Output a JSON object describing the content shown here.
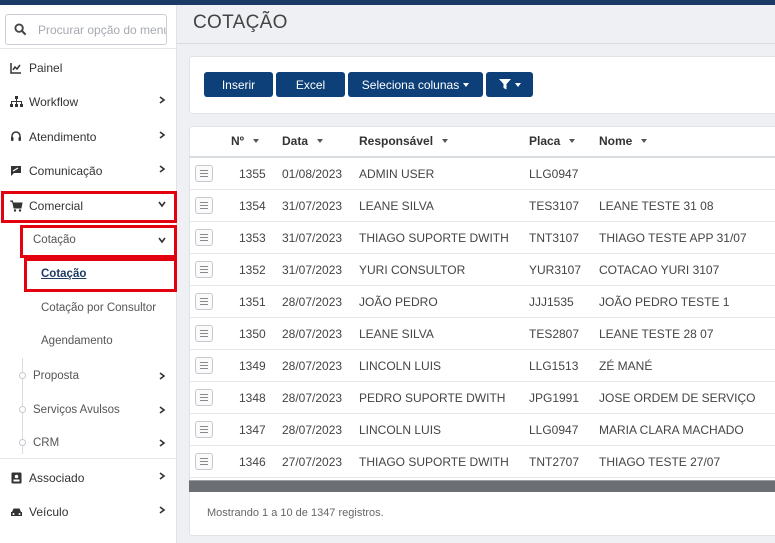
{
  "sidebar": {
    "search_placeholder": "Procurar opção do menu",
    "items": [
      {
        "label": "Painel",
        "icon": "chart-line-icon"
      },
      {
        "label": "Workflow",
        "icon": "sitemap-icon"
      },
      {
        "label": "Atendimento",
        "icon": "headset-icon"
      },
      {
        "label": "Comunicação",
        "icon": "message-icon"
      },
      {
        "label": "Comercial",
        "icon": "cart-icon"
      },
      {
        "label": "Associado",
        "icon": "id-card-icon"
      },
      {
        "label": "Veículo",
        "icon": "car-icon"
      }
    ],
    "comercial_children": {
      "cotacao_group": "Cotação",
      "cotacao_links": [
        "Cotação",
        "Cotação por Consultor",
        "Agendamento"
      ],
      "others": [
        "Proposta",
        "Serviços Avulsos",
        "CRM"
      ]
    }
  },
  "page": {
    "title": "COTAÇÃO"
  },
  "toolbar": {
    "insert": "Inserir",
    "excel": "Excel",
    "columns": "Seleciona colunas",
    "filter_icon": "filter-icon"
  },
  "table": {
    "headers": [
      "Nº",
      "Data",
      "Responsável",
      "Placa",
      "Nome"
    ],
    "rows": [
      {
        "num": "1355",
        "data": "01/08/2023",
        "resp": "ADMIN USER",
        "placa": "LLG0947",
        "nome": ""
      },
      {
        "num": "1354",
        "data": "31/07/2023",
        "resp": "LEANE SILVA",
        "placa": "TES3107",
        "nome": "LEANE TESTE 31 08"
      },
      {
        "num": "1353",
        "data": "31/07/2023",
        "resp": "THIAGO SUPORTE DWITH",
        "placa": "TNT3107",
        "nome": "THIAGO TESTE APP 31/07"
      },
      {
        "num": "1352",
        "data": "31/07/2023",
        "resp": "YURI CONSULTOR",
        "placa": "YUR3107",
        "nome": "COTACAO YURI 3107"
      },
      {
        "num": "1351",
        "data": "28/07/2023",
        "resp": "JOÃO PEDRO",
        "placa": "JJJ1535",
        "nome": "JOÃO PEDRO TESTE 1"
      },
      {
        "num": "1350",
        "data": "28/07/2023",
        "resp": "LEANE SILVA",
        "placa": "TES2807",
        "nome": "LEANE TESTE 28 07"
      },
      {
        "num": "1349",
        "data": "28/07/2023",
        "resp": "LINCOLN LUIS",
        "placa": "LLG1513",
        "nome": "ZÉ MANÉ"
      },
      {
        "num": "1348",
        "data": "28/07/2023",
        "resp": "PEDRO SUPORTE DWITH",
        "placa": "JPG1991",
        "nome": "JOSE ORDEM DE SERVIÇO"
      },
      {
        "num": "1347",
        "data": "28/07/2023",
        "resp": "LINCOLN LUIS",
        "placa": "LLG0947",
        "nome": "MARIA CLARA MACHADO"
      },
      {
        "num": "1346",
        "data": "27/07/2023",
        "resp": "THIAGO SUPORTE DWITH",
        "placa": "TNT2707",
        "nome": "THIAGO TESTE 27/07"
      }
    ],
    "footer": "Mostrando 1 a 10 de 1347 registros."
  },
  "colors": {
    "primary_button": "#0d3f79",
    "highlight_box": "#e3000f"
  }
}
